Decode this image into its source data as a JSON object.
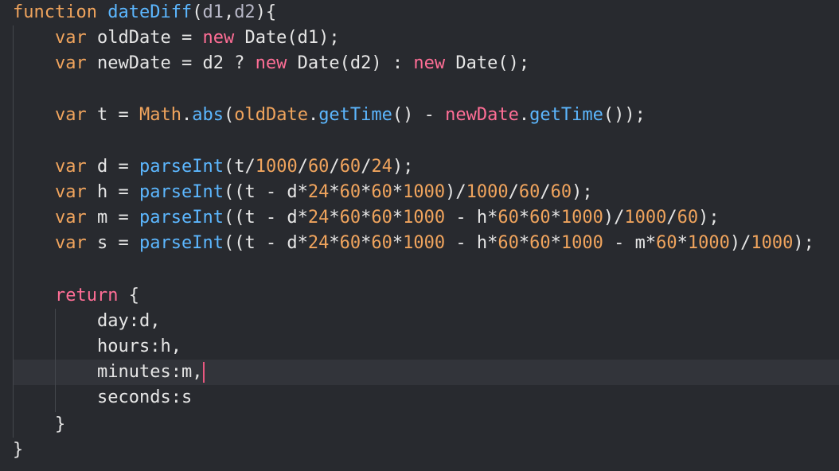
{
  "editor": {
    "colors": {
      "background": "#282a2f",
      "keyword": "#f0a45d",
      "keyword_new_return": "#ff6e96",
      "function": "#5cb7ff",
      "number": "#f0a45d",
      "text": "#e6e6e6",
      "caret": "#e8577f"
    },
    "code": {
      "l1": {
        "kw": "function",
        "name": "dateDiff",
        "open": "(",
        "p1": "d1",
        "comma": ",",
        "p2": "d2",
        "close": "){"
      },
      "l2": {
        "kw": "var",
        "rest1": " oldDate = ",
        "new": "new",
        "rest2": " Date(d1);"
      },
      "l3": {
        "kw": "var",
        "rest1": " newDate = d2 ? ",
        "new1": "new",
        "rest2": " Date(d2) : ",
        "new2": "new",
        "rest3": " Date();"
      },
      "l5": {
        "kw": "var",
        "rest1": " t = ",
        "math": "Math",
        "dot1": ".",
        "abs": "abs",
        "paren": "(",
        "old": "oldDate",
        "dot2": ".",
        "gt1": "getTime",
        "mid": "() - ",
        "newd": "newDate",
        "dot3": ".",
        "gt2": "getTime",
        "end": "());"
      },
      "l7": {
        "kw": "var",
        "rest1": " d = ",
        "fn": "parseInt",
        "a": "(t/",
        "n1": "1000",
        "s1": "/",
        "n2": "60",
        "s2": "/",
        "n3": "60",
        "s3": "/",
        "n4": "24",
        "end": ");"
      },
      "l8": {
        "kw": "var",
        "rest1": " h = ",
        "fn": "parseInt",
        "a": "((t - d*",
        "n1": "24",
        "s1": "*",
        "n2": "60",
        "s2": "*",
        "n3": "60",
        "s3": "*",
        "n4": "1000",
        "s4": ")/",
        "n5": "1000",
        "s5": "/",
        "n6": "60",
        "s6": "/",
        "n7": "60",
        "end": ");"
      },
      "l9": {
        "kw": "var",
        "rest1": " m = ",
        "fn": "parseInt",
        "a": "((t - d*",
        "n1": "24",
        "s1": "*",
        "n2": "60",
        "s2": "*",
        "n3": "60",
        "s3": "*",
        "n4": "1000",
        "s4": " - h*",
        "n5": "60",
        "s5": "*",
        "n6": "60",
        "s6": "*",
        "n7": "1000",
        "s7": ")/",
        "n8": "1000",
        "s8": "/",
        "n9": "60",
        "end": ");"
      },
      "l10": {
        "kw": "var",
        "rest1": " s = ",
        "fn": "parseInt",
        "a": "((t - d*",
        "n1": "24",
        "s1": "*",
        "n2": "60",
        "s2": "*",
        "n3": "60",
        "s3": "*",
        "n4": "1000",
        "s4": " - h*",
        "n5": "60",
        "s5": "*",
        "n6": "60",
        "s6": "*",
        "n7": "1000",
        "s7": " - m*",
        "n8": "60",
        "s8": "*",
        "n9": "1000",
        "s9": ")/",
        "n10": "1000",
        "end": ");"
      },
      "l12": {
        "ret": "return",
        "rest": " {"
      },
      "l13": "day:d,",
      "l14": "hours:h,",
      "l15": "minutes:m,",
      "l16": "seconds:s",
      "l17": "}",
      "l18": "}"
    }
  }
}
